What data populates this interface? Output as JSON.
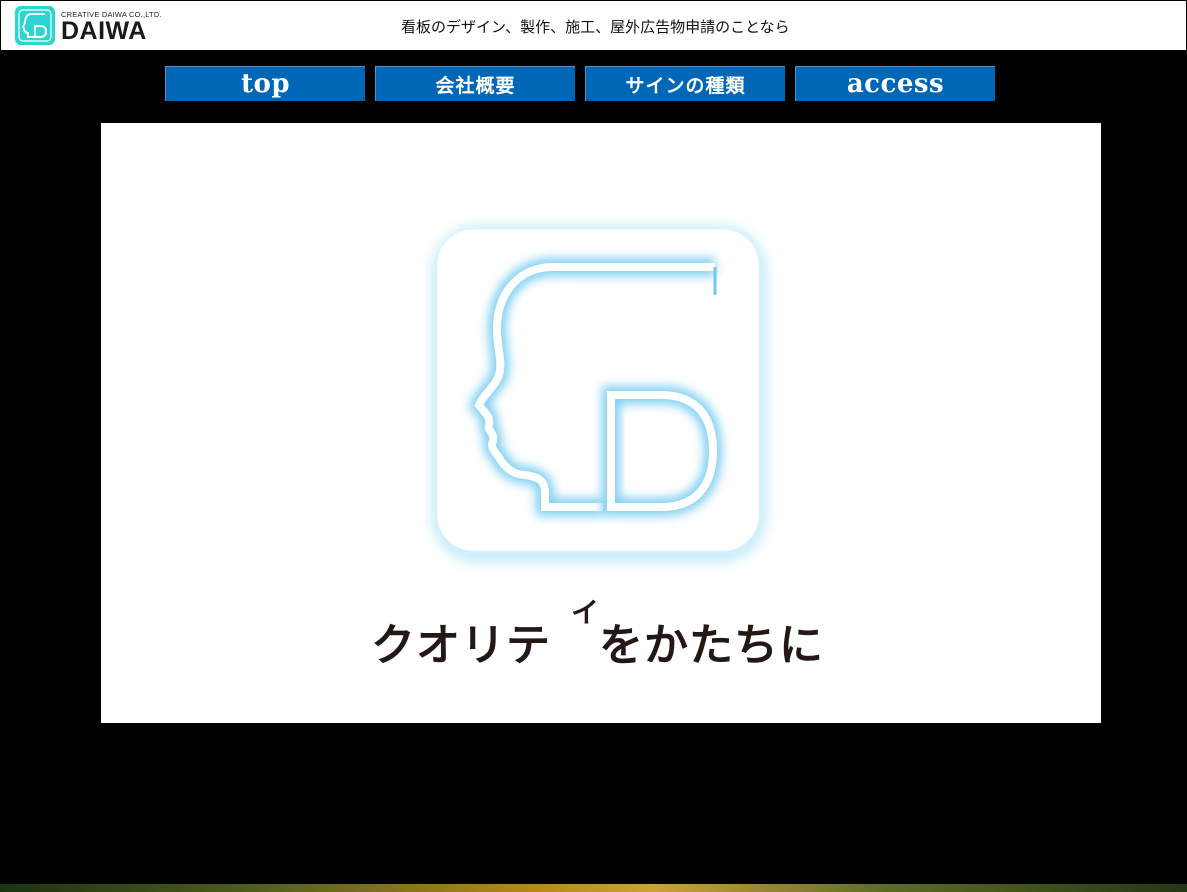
{
  "header": {
    "logo": {
      "company": "CREATIVE DAIWA CO.,LTD.",
      "name": "DAIWA",
      "icon": "cd-face-logo-icon"
    },
    "tagline": "看板のデザイン、製作、施工、屋外広告物申請のことなら"
  },
  "nav": {
    "items": [
      {
        "label": "top"
      },
      {
        "label": "会社概要"
      },
      {
        "label": "サインの種類"
      },
      {
        "label": "access"
      }
    ]
  },
  "hero": {
    "icon": "cd-face-logo-icon",
    "slogan": {
      "part1": "クオリテ",
      "part2": "イ",
      "part3": "をかたちに"
    }
  },
  "colors": {
    "nav_bg": "#0066b6",
    "page_bg": "#000000",
    "logo_accent": "#2ad6d2",
    "hero_glow": "#8ad8f5",
    "slogan_text": "#231815"
  }
}
